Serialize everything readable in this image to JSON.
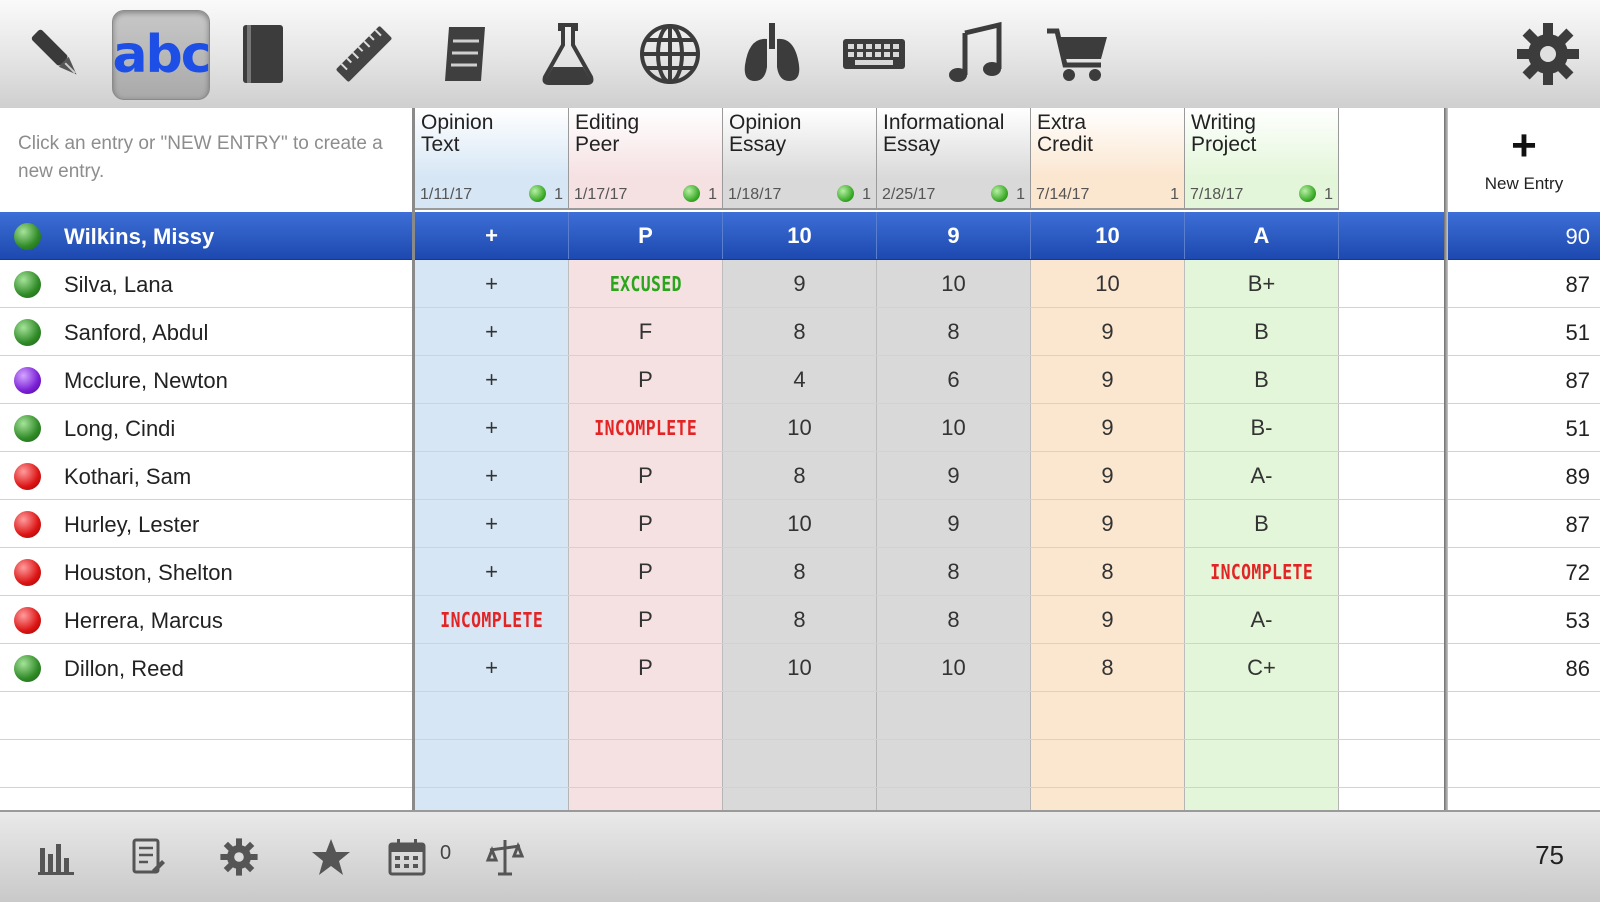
{
  "toolbar": {
    "icons": [
      "pen-icon",
      "abc-icon",
      "book-icon",
      "ruler-icon",
      "scroll-icon",
      "flask-icon",
      "globe-icon",
      "lungs-icon",
      "keyboard-icon",
      "music-note-icon",
      "cart-icon",
      "gear-icon"
    ],
    "abc_label": "abc"
  },
  "header": {
    "instructions": "Click an entry or \"NEW ENTRY\" to create a new entry.",
    "new_entry_label": "New Entry",
    "columns": [
      {
        "title": "Opinion\nText",
        "date": "1/11/17",
        "count": "1",
        "dot": true,
        "bg": "#d6e6f5"
      },
      {
        "title": "Editing\nPeer",
        "date": "1/17/17",
        "count": "1",
        "dot": true,
        "bg": "#f5e0e2"
      },
      {
        "title": "Opinion\nEssay",
        "date": "1/18/17",
        "count": "1",
        "dot": true,
        "bg": "#d9d9d9"
      },
      {
        "title": "Informational\nEssay",
        "date": "2/25/17",
        "count": "1",
        "dot": true,
        "bg": "#d9d9d9"
      },
      {
        "title": "Extra\nCredit",
        "date": "7/14/17",
        "count": "1",
        "dot": false,
        "bg": "#fbe6cf"
      },
      {
        "title": "Writing\nProject",
        "date": "7/18/17",
        "count": "1",
        "dot": true,
        "bg": "#e3f6d9"
      }
    ]
  },
  "students": [
    {
      "name": "Wilkins, Missy",
      "status": "green",
      "scores": [
        "+",
        "P",
        "10",
        "9",
        "10",
        "A"
      ],
      "total": "90",
      "selected": true
    },
    {
      "name": "Silva, Lana",
      "status": "green",
      "scores": [
        "+",
        "EXCUSED",
        "9",
        "10",
        "10",
        "B+"
      ],
      "total": "87"
    },
    {
      "name": "Sanford, Abdul",
      "status": "green",
      "scores": [
        "+",
        "F",
        "8",
        "8",
        "9",
        "B"
      ],
      "total": "51"
    },
    {
      "name": "Mcclure, Newton",
      "status": "purple",
      "scores": [
        "+",
        "P",
        "4",
        "6",
        "9",
        "B"
      ],
      "total": "87"
    },
    {
      "name": "Long, Cindi",
      "status": "green",
      "scores": [
        "+",
        "INCOMPLETE",
        "10",
        "10",
        "9",
        "B-"
      ],
      "total": "51"
    },
    {
      "name": "Kothari, Sam",
      "status": "red",
      "scores": [
        "+",
        "P",
        "8",
        "9",
        "9",
        "A-"
      ],
      "total": "89"
    },
    {
      "name": "Hurley, Lester",
      "status": "red",
      "scores": [
        "+",
        "P",
        "10",
        "9",
        "9",
        "B"
      ],
      "total": "87"
    },
    {
      "name": "Houston, Shelton",
      "status": "red",
      "scores": [
        "+",
        "P",
        "8",
        "8",
        "8",
        "INCOMPLETE"
      ],
      "total": "72"
    },
    {
      "name": "Herrera, Marcus",
      "status": "red",
      "scores": [
        "INCOMPLETE",
        "P",
        "8",
        "8",
        "9",
        "A-"
      ],
      "total": "53"
    },
    {
      "name": "Dillon, Reed",
      "status": "green",
      "scores": [
        "+",
        "P",
        "10",
        "10",
        "8",
        "C+"
      ],
      "total": "86"
    }
  ],
  "bottombar": {
    "icons": [
      "bar-chart-icon",
      "notes-icon",
      "settings-gear-icon",
      "star-icon",
      "calendar-icon",
      "balance-icon"
    ],
    "calendar_count": "0",
    "class_average": "75"
  }
}
